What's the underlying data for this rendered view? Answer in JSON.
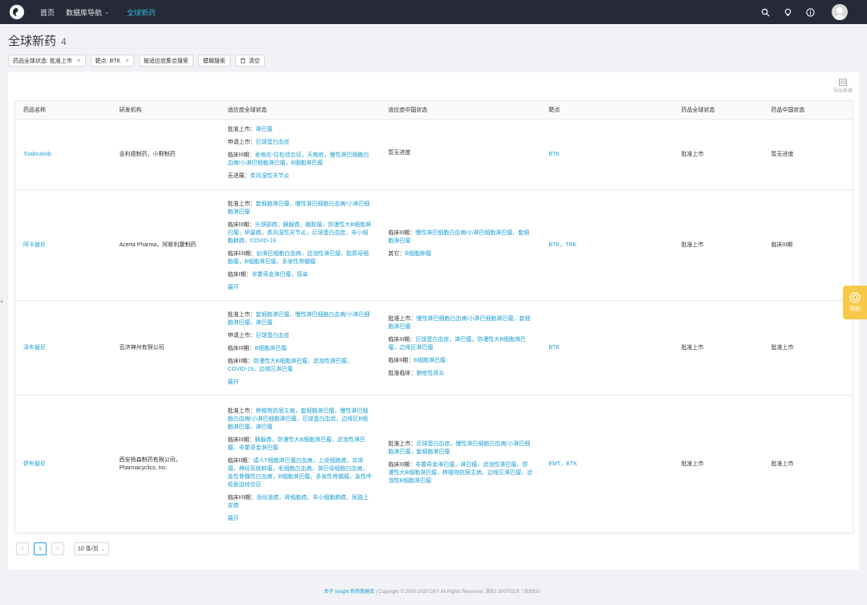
{
  "topbar": {
    "nav": [
      {
        "label": "首页"
      },
      {
        "label": "数据库导航"
      },
      {
        "label": "全球新药"
      }
    ]
  },
  "page": {
    "title": "全球新药",
    "count": "4"
  },
  "filters": [
    {
      "label": "药品全球状态: 批准上市"
    },
    {
      "label": "靶点: BTK"
    },
    {
      "label": "按适应症集合搜索"
    },
    {
      "label": "模糊搜索"
    },
    {
      "label": "清空"
    }
  ],
  "export_label": "导出表格",
  "table": {
    "headers": [
      "药品名称",
      "研发机构",
      "适应症全球状态",
      "适应症中国状态",
      "靶点",
      "药品全球状态",
      "药品中国状态"
    ],
    "rows": [
      {
        "name": "Tirabrutinib",
        "org": "吉利德制药，小野制药",
        "global": [
          {
            "label": "批准上市：",
            "value": "淋巴瘤"
          },
          {
            "label": "申请上市：",
            "value": "巨球蛋白血症"
          },
          {
            "label": "临床III期：",
            "value": "舍格伦-拉松综合征，天疱疮，慢性淋巴细胞白血病/小淋巴细胞淋巴瘤，B细胞淋巴瘤"
          },
          {
            "label": "无进展：",
            "value": "类风湿性关节炎"
          }
        ],
        "global_expand": "",
        "china": [
          {
            "label": "",
            "value": "暂无进度"
          }
        ],
        "target": "BTK",
        "global_status": "批准上市",
        "china_status": "暂无进度"
      },
      {
        "name": "阿卡替尼",
        "org": "Acerta Pharma，阿斯利康制药",
        "global": [
          {
            "label": "批准上市：",
            "value": "套细胞淋巴瘤，慢性淋巴细胞白血病/小淋巴细胞淋巴瘤"
          },
          {
            "label": "临床III期：",
            "value": "头颈部癌，胰腺癌，脑胶瘤，弥漫性大B细胞淋巴瘤，卵巢癌，类风湿性关节炎，巨球蛋白血症，非小细胞肺癌，COVID-19"
          },
          {
            "label": "临床I/II期：",
            "value": "幼淋巴细胞白血病，滤泡性淋巴瘤，胶质母细胞瘤，B细胞淋巴瘤，多发性骨髓瘤"
          },
          {
            "label": "临床I期：",
            "value": "非霍奇金淋巴瘤，感染"
          }
        ],
        "global_expand": "展开",
        "china": [
          {
            "label": "临床III期：",
            "value": "慢性淋巴细胞白血病/小淋巴细胞淋巴瘤，套细胞淋巴瘤"
          },
          {
            "label": "其它：",
            "value": "B细胞肿瘤"
          }
        ],
        "target": "BTK，TRK",
        "global_status": "批准上市",
        "china_status": "临床III期"
      },
      {
        "name": "泽布替尼",
        "org": "百济神州有限公司",
        "global": [
          {
            "label": "批准上市：",
            "value": "套细胞淋巴瘤，慢性淋巴细胞白血病/小淋巴细胞淋巴瘤，淋巴瘤"
          },
          {
            "label": "申请上市：",
            "value": "巨球蛋白血症"
          },
          {
            "label": "临床III期：",
            "value": "B细胞淋巴瘤"
          },
          {
            "label": "临床II期：",
            "value": "弥漫性大B细胞淋巴瘤，滤泡性淋巴瘤，COVID-19，边缘区淋巴瘤"
          }
        ],
        "global_expand": "展开",
        "china": [
          {
            "label": "批准上市：",
            "value": "慢性淋巴细胞白血病/小淋巴细胞淋巴瘤，套细胞淋巴瘤"
          },
          {
            "label": "临床III期：",
            "value": "巨球蛋白血症，淋巴瘤，弥漫性大B细胞淋巴瘤，边缘区淋巴瘤"
          },
          {
            "label": "临床II期：",
            "value": "B细胞淋巴瘤"
          },
          {
            "label": "批准临床：",
            "value": "狼疮性肾炎"
          }
        ],
        "target": "BTK",
        "global_status": "批准上市",
        "china_status": "批准上市"
      },
      {
        "name": "伊布替尼",
        "org": "西安杨森制药有限公司，Pharmacyclics, Inc.",
        "global": [
          {
            "label": "批准上市：",
            "value": "移植物抗宿主病，套细胞淋巴瘤，慢性淋巴细胞白血病/小淋巴细胞淋巴瘤，巨球蛋白血症，边缘区B细胞淋巴瘤，淋巴瘤"
          },
          {
            "label": "临床III期：",
            "value": "胰腺癌，弥漫性大B细胞淋巴瘤，滤泡性淋巴瘤，非霍奇金淋巴瘤"
          },
          {
            "label": "临床II期：",
            "value": "成人T细胞淋巴瘤白血病，上皮细胞癌，实体瘤，神经系统肿瘤，毛细胞白血病，淋巴母细胞白血病，急性骨髓性白血病，B细胞淋巴瘤，多发性骨髓瘤，急性呼吸窘迫综合征"
          },
          {
            "label": "临床I/II期：",
            "value": "消化道癌，肾细胞癌，非小细胞肺癌，尿路上皮癌"
          }
        ],
        "global_expand": "展开",
        "china": [
          {
            "label": "批准上市：",
            "value": "巨球蛋白血症，慢性淋巴细胞白血病/小淋巴细胞淋巴瘤，套细胞淋巴瘤"
          },
          {
            "label": "临床III期：",
            "value": "非霍奇金淋巴瘤，淋巴瘤，滤泡性淋巴瘤，弥漫性大B细胞淋巴瘤，移植物抗宿主病，边缘区淋巴瘤，滤泡性B细胞淋巴瘤"
          }
        ],
        "target": "EMT，BTK",
        "global_status": "批准上市",
        "china_status": "批准上市"
      }
    ]
  },
  "pagination": {
    "prev": "<",
    "current": "1",
    "next": ">",
    "page_size": "10 条/页"
  },
  "footer": {
    "link": "关于 Insight 新药数据库",
    "copyright": "| Copyright © 2000-2020 DXY All Rights Reserved. 浙B2-20070219（含BBS）"
  },
  "help_label": "帮助"
}
